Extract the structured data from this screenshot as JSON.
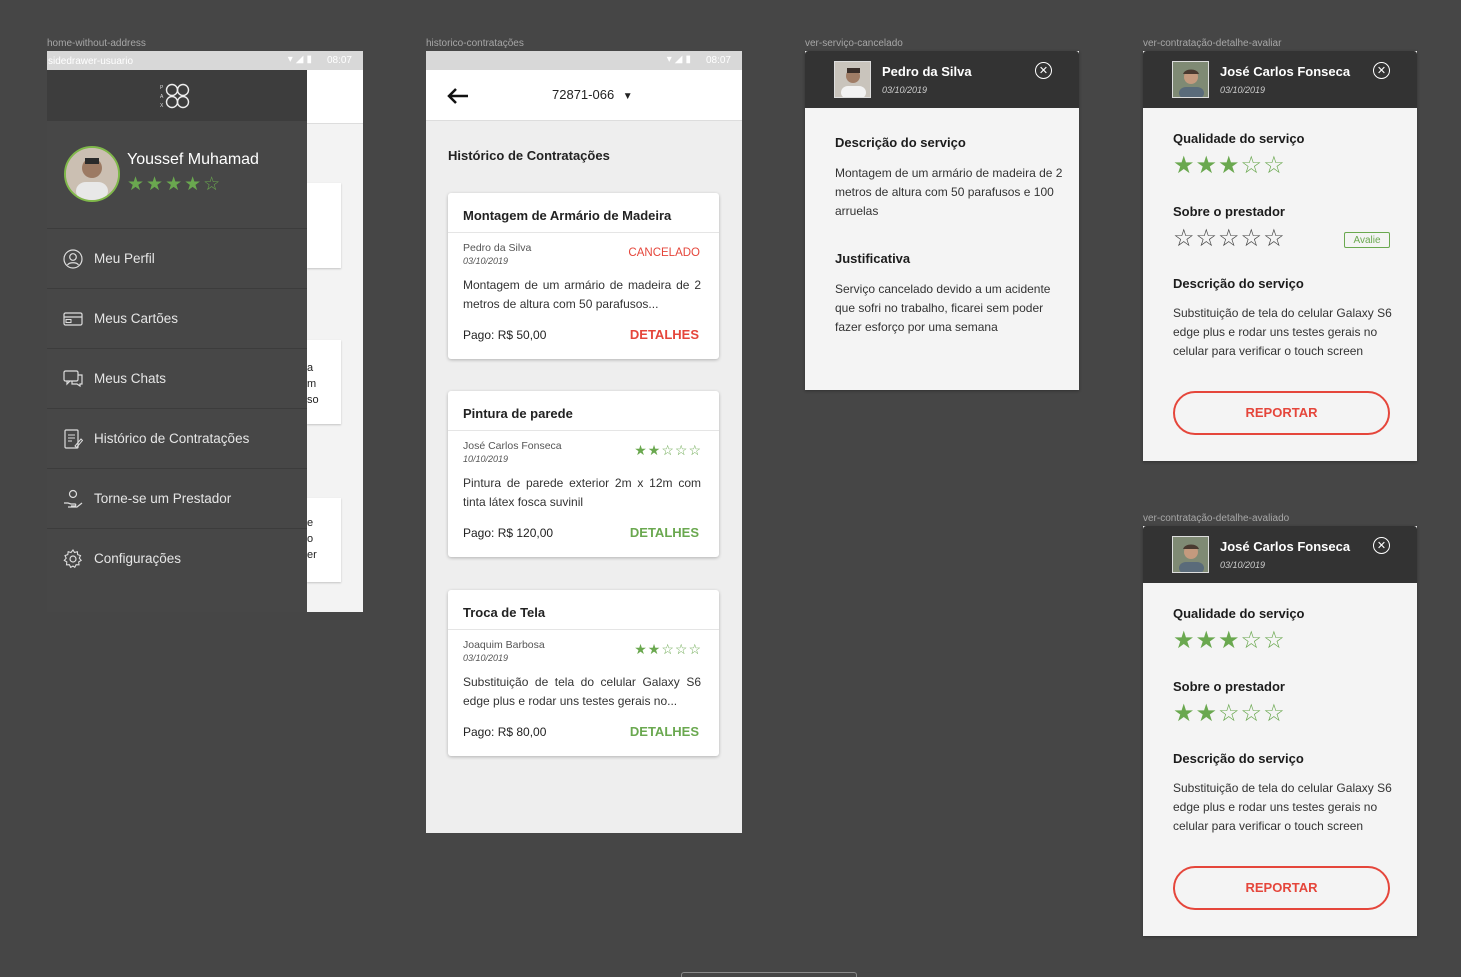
{
  "labels": {
    "frame1": "home-without-address",
    "frame1_sub": "sidedrawer-usuario",
    "frame2": "historico-contratações",
    "frame3": "ver-serviço-cancelado",
    "frame4": "ver-contratação-detalhe-avaliar",
    "frame5": "ver-contratação-detalhe-avaliado"
  },
  "status": {
    "time": "08:07"
  },
  "drawer": {
    "logo_letters": "P A X",
    "user_name": "Youssef Muhamad",
    "user_stars": "★★★★☆",
    "items": [
      {
        "label": "Meu Perfil",
        "icon": "user-icon"
      },
      {
        "label": "Meus Cartões",
        "icon": "card-icon"
      },
      {
        "label": "Meus Chats",
        "icon": "chat-icon"
      },
      {
        "label": "Histórico de Contratações",
        "icon": "document-icon"
      },
      {
        "label": "Torne-se um Prestador",
        "icon": "hand-icon"
      },
      {
        "label": "Configurações",
        "icon": "gear-icon"
      }
    ],
    "peek_text": [
      "a",
      "m",
      "so",
      "e",
      "o",
      "er"
    ]
  },
  "history": {
    "cep": "72871-066",
    "heading": "Histórico de Contratações",
    "cards": [
      {
        "title": "Montagem de Armário de Madeira",
        "provider": "Pedro da Silva",
        "date": "03/10/2019",
        "status": "CANCELADO",
        "stars": "",
        "desc": "Montagem de um armário de madeira de 2 metros de altura com 50 parafusos...",
        "paid": "Pago: R$ 50,00",
        "details": "DETALHES"
      },
      {
        "title": "Pintura de parede",
        "provider": "José Carlos Fonseca",
        "date": "10/10/2019",
        "status": "",
        "stars": "★★☆☆☆",
        "desc": "Pintura de parede exterior 2m x 12m com tinta látex fosca suvinil",
        "paid": "Pago: R$ 120,00",
        "details": "DETALHES"
      },
      {
        "title": "Troca de Tela",
        "provider": "Joaquim Barbosa",
        "date": "03/10/2019",
        "status": "",
        "stars": "★★☆☆☆",
        "desc": "Substituição de tela do celular Galaxy S6 edge plus e rodar uns testes gerais no...",
        "paid": "Pago: R$ 80,00",
        "details": "DETALHES"
      }
    ]
  },
  "cancelled": {
    "name": "Pedro da Silva",
    "date": "03/10/2019",
    "desc_title": "Descrição do serviço",
    "desc": "Montagem de um armário de madeira de 2 metros de altura com 50 parafusos e 100 arruelas",
    "just_title": "Justificativa",
    "just": "Serviço cancelado devido a um acidente que sofri no trabalho, ficarei sem poder fazer esforço por uma semana"
  },
  "rate": {
    "name": "José Carlos Fonseca",
    "date": "03/10/2019",
    "quality_title": "Qualidade do serviço",
    "quality_stars": "★★★☆☆",
    "provider_title": "Sobre o prestador",
    "provider_stars": "☆☆☆☆☆",
    "avalie": "Avalie",
    "desc_title": "Descrição do serviço",
    "desc": "Substituição de tela do celular Galaxy S6 edge plus e rodar uns testes gerais no celular para verificar o touch screen",
    "report": "REPORTAR"
  },
  "rated": {
    "name": "José Carlos Fonseca",
    "date": "03/10/2019",
    "quality_title": "Qualidade do serviço",
    "quality_stars": "★★★☆☆",
    "provider_title": "Sobre o prestador",
    "provider_stars": "★★☆☆☆",
    "desc_title": "Descrição do serviço",
    "desc": "Substituição de tela do celular Galaxy S6 edge plus e rodar uns testes gerais no celular para verificar o touch screen",
    "report": "REPORTAR"
  },
  "colors": {
    "accent_green": "#6aa84f",
    "accent_red": "#e5463b",
    "dark": "#474747"
  }
}
